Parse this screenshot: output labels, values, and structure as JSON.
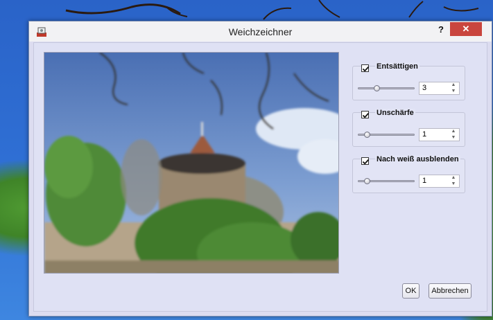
{
  "dialog": {
    "title": "Weichzeichner",
    "help_label": "?",
    "close_label": "✕"
  },
  "preview": {
    "description_icon": "photo-preview"
  },
  "effects": [
    {
      "label": "Entsättigen",
      "checked": true,
      "slider_level": 0.32,
      "value": "3"
    },
    {
      "label": "Unschärfe",
      "checked": true,
      "slider_level": 0.12,
      "value": "1"
    },
    {
      "label": "Nach weiß ausblenden",
      "checked": true,
      "slider_level": 0.12,
      "value": "1"
    }
  ],
  "buttons": {
    "ok_label": "OK",
    "cancel_label": "Abbrechen"
  },
  "colors": {
    "close_button": "#c9453e",
    "dialog_background": "#dfe1f4"
  }
}
